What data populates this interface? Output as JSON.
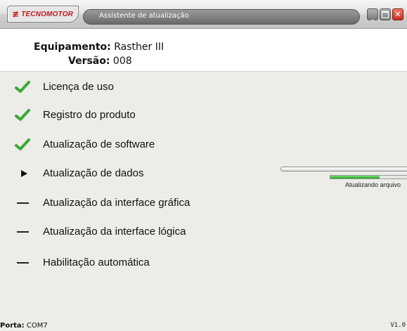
{
  "window": {
    "logo_mark": "≢",
    "logo_text": "TECNOMOTOR",
    "title": "Assistente de atualização",
    "controls": {
      "minimize_icon": "minimize-icon",
      "maximize_icon": "maximize-icon",
      "close_icon": "close-icon"
    }
  },
  "header": {
    "equipment_label": "Equipamento:",
    "equipment_value": " Rasther III",
    "version_label": "Versão:",
    "version_value": " 008"
  },
  "steps": [
    {
      "label": "Licença de uso",
      "status": "done",
      "icon": "checkmark-icon"
    },
    {
      "label": "Registro do produto",
      "status": "done",
      "icon": "checkmark-icon"
    },
    {
      "label": "Atualização de software",
      "status": "done",
      "icon": "checkmark-icon"
    },
    {
      "label": "Atualização de dados",
      "status": "in-progress",
      "icon": "play-arrow-icon"
    },
    {
      "label": "Atualização da interface gráfica",
      "status": "pending",
      "icon": "dash-icon"
    },
    {
      "label": "Atualização da interface lógica",
      "status": "pending",
      "icon": "dash-icon"
    },
    {
      "label": "Habilitação automática",
      "status": "pending",
      "icon": "dash-icon"
    }
  ],
  "progress": {
    "overall": 0.0,
    "file": 0.62,
    "status_text": "Atualizando arquivo"
  },
  "footer": {
    "port_label": "Porta:",
    "port_value": " COM7",
    "version": "V1.0"
  },
  "colors": {
    "check": "#3aa935",
    "progress_fill": "#2db52d",
    "logo": "#c4181e"
  }
}
